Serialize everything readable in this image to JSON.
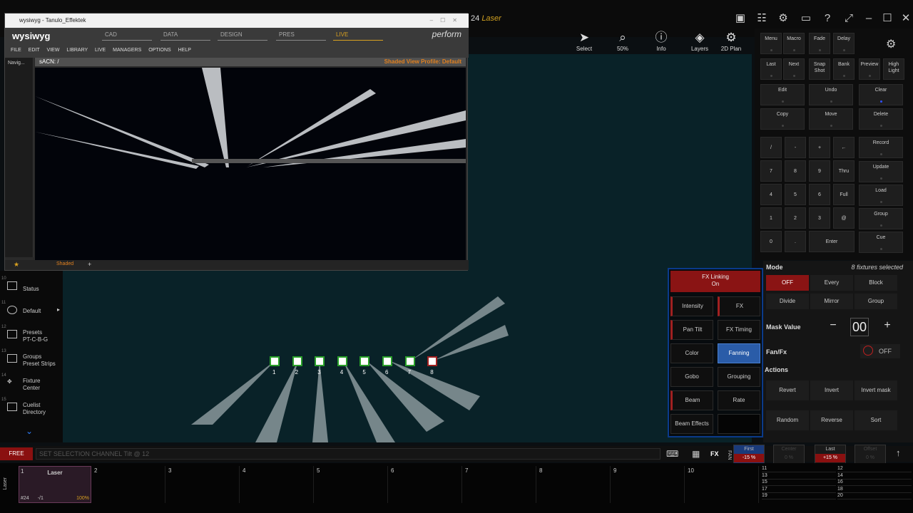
{
  "topbar": {
    "show_num": "24",
    "show_name": "Laser"
  },
  "toolbar": {
    "select": "Select",
    "zoom": "50%",
    "info": "Info",
    "layers": "Layers",
    "plan": "2D Plan"
  },
  "wys": {
    "title": "wysiwyg - Tanulo_Effektek",
    "logo": "wysiwyg",
    "tabs": [
      "CAD",
      "DATA",
      "DESIGN",
      "PRES",
      "LIVE"
    ],
    "perform": "perform",
    "menu": [
      "FILE",
      "EDIT",
      "VIEW",
      "LIBRARY",
      "LIVE",
      "MANAGERS",
      "OPTIONS",
      "HELP"
    ],
    "nav": "Navig...",
    "path": "sACN: /",
    "profile": "Shaded View Profile: Default",
    "shaded": "Shaded",
    "plus": "+"
  },
  "left": [
    {
      "n": "10",
      "t": "Status"
    },
    {
      "n": "11",
      "t": "Default"
    },
    {
      "n": "12",
      "t": "Presets",
      "s": "PT-C-B-G"
    },
    {
      "n": "13",
      "t": "Groups",
      "s": "Preset Strips"
    },
    {
      "n": "14",
      "t": "Fixture",
      "s": "Center"
    },
    {
      "n": "15",
      "t": "Cuelist",
      "s": "Directory"
    }
  ],
  "fixtures": [
    "1",
    "2",
    "3",
    "4",
    "5",
    "6",
    "7",
    "8"
  ],
  "keys": {
    "row1": [
      "Menu",
      "Macro",
      "Fade",
      "Delay"
    ],
    "row2": [
      "Last",
      "Next",
      "Snap Shot",
      "Bank",
      "Preview",
      "High Light"
    ],
    "edit": "Edit",
    "undo": "Undo",
    "clear": "Clear",
    "copy": "Copy",
    "move": "Move",
    "delete": "Delete",
    "pad": [
      "/",
      "-",
      "+",
      "←",
      "7",
      "8",
      "9",
      "Thru",
      "4",
      "5",
      "6",
      "Full",
      "1",
      "2",
      "3",
      "@",
      "0",
      ".",
      "Enter"
    ],
    "side": [
      "Record",
      "Update",
      "Load",
      "Group",
      "Cue"
    ]
  },
  "fx": {
    "link": "FX Linking",
    "link2": "On",
    "buttons": [
      "Intensity",
      "FX",
      "Pan Tilt",
      "FX Timing",
      "Color",
      "Fanning",
      "Gobo",
      "Grouping",
      "Beam",
      "Rate",
      "Beam Effects"
    ]
  },
  "mode": {
    "title": "Mode",
    "selected": "8 fixtures selected",
    "btns": [
      "OFF",
      "Every",
      "Block",
      "Divide",
      "Mirror",
      "Group"
    ],
    "mask": "Mask Value",
    "mask_val": "00",
    "fanfx": "Fan/Fx",
    "fan_state": "OFF",
    "actions": "Actions",
    "act": [
      "Revert",
      "Invert",
      "Invert mask",
      "Random",
      "Reverse",
      "Sort"
    ]
  },
  "cmd": {
    "free": "FREE",
    "line": "SET SELECTION CHANNEL Tilt @ 12"
  },
  "faders": {
    "fx": "FX",
    "fan": "FAN",
    "first": "First",
    "first_val": "-15 %",
    "center": "Center",
    "center_val": "0 %",
    "last": "Last",
    "last_val": "+15 %",
    "offset": "Offset",
    "offset_val": "0 %"
  },
  "cues": {
    "side": "Laser",
    "cells": [
      "1",
      "2",
      "3",
      "4",
      "5",
      "6",
      "7",
      "8",
      "9",
      "10"
    ],
    "c1_label": "Laser",
    "c1_a": "#24",
    "c1_b": "-/1",
    "c1_c": "100%",
    "right": [
      "11",
      "12",
      "13",
      "14",
      "15",
      "16",
      "17",
      "18",
      "19",
      "20"
    ]
  }
}
